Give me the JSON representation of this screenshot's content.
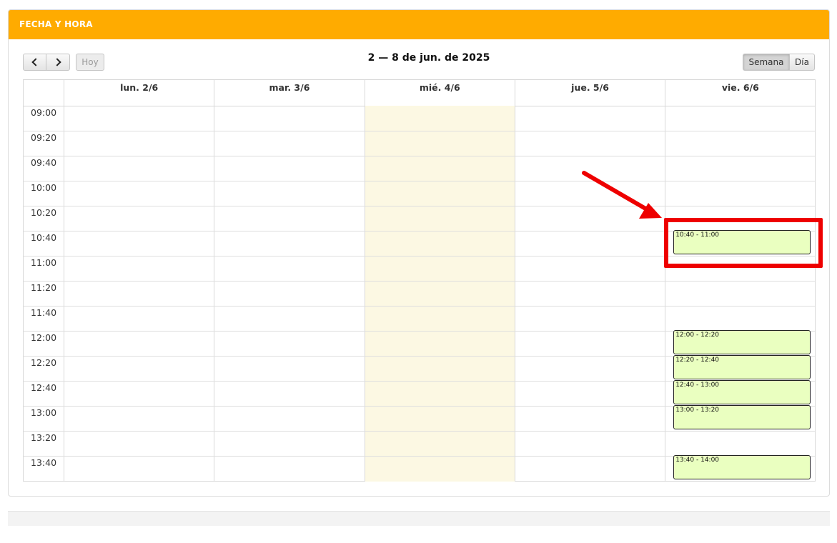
{
  "panel": {
    "title": "FECHA Y HORA"
  },
  "toolbar": {
    "prev_icon": "chevron-left-icon",
    "next_icon": "chevron-right-icon",
    "today_label": "Hoy",
    "range_title": "2 — 8 de jun. de 2025",
    "views": [
      "Semana",
      "Día"
    ],
    "active_view": "Semana"
  },
  "days": [
    "lun. 2/6",
    "mar. 3/6",
    "mié. 4/6",
    "jue. 5/6",
    "vie. 6/6"
  ],
  "today_index": 2,
  "times": [
    "09:00",
    "09:20",
    "09:40",
    "10:00",
    "10:20",
    "10:40",
    "11:00",
    "11:20",
    "11:40",
    "12:00",
    "12:20",
    "12:40",
    "13:00",
    "13:20",
    "13:40"
  ],
  "events": [
    {
      "day": 4,
      "slot": 5,
      "label": "10:40 - 11:00"
    },
    {
      "day": 4,
      "slot": 9,
      "label": "12:00 - 12:20"
    },
    {
      "day": 4,
      "slot": 10,
      "label": "12:20 - 12:40"
    },
    {
      "day": 4,
      "slot": 11,
      "label": "12:40 - 13:00"
    },
    {
      "day": 4,
      "slot": 12,
      "label": "13:00 - 13:20"
    },
    {
      "day": 4,
      "slot": 14,
      "label": "13:40 - 14:00"
    }
  ],
  "annotation": {
    "color": "#ee0000",
    "highlight_event": 0
  },
  "colors": {
    "header": "#ffab00",
    "event_bg": "#eaffc0",
    "today_bg": "#fcf8e3"
  }
}
